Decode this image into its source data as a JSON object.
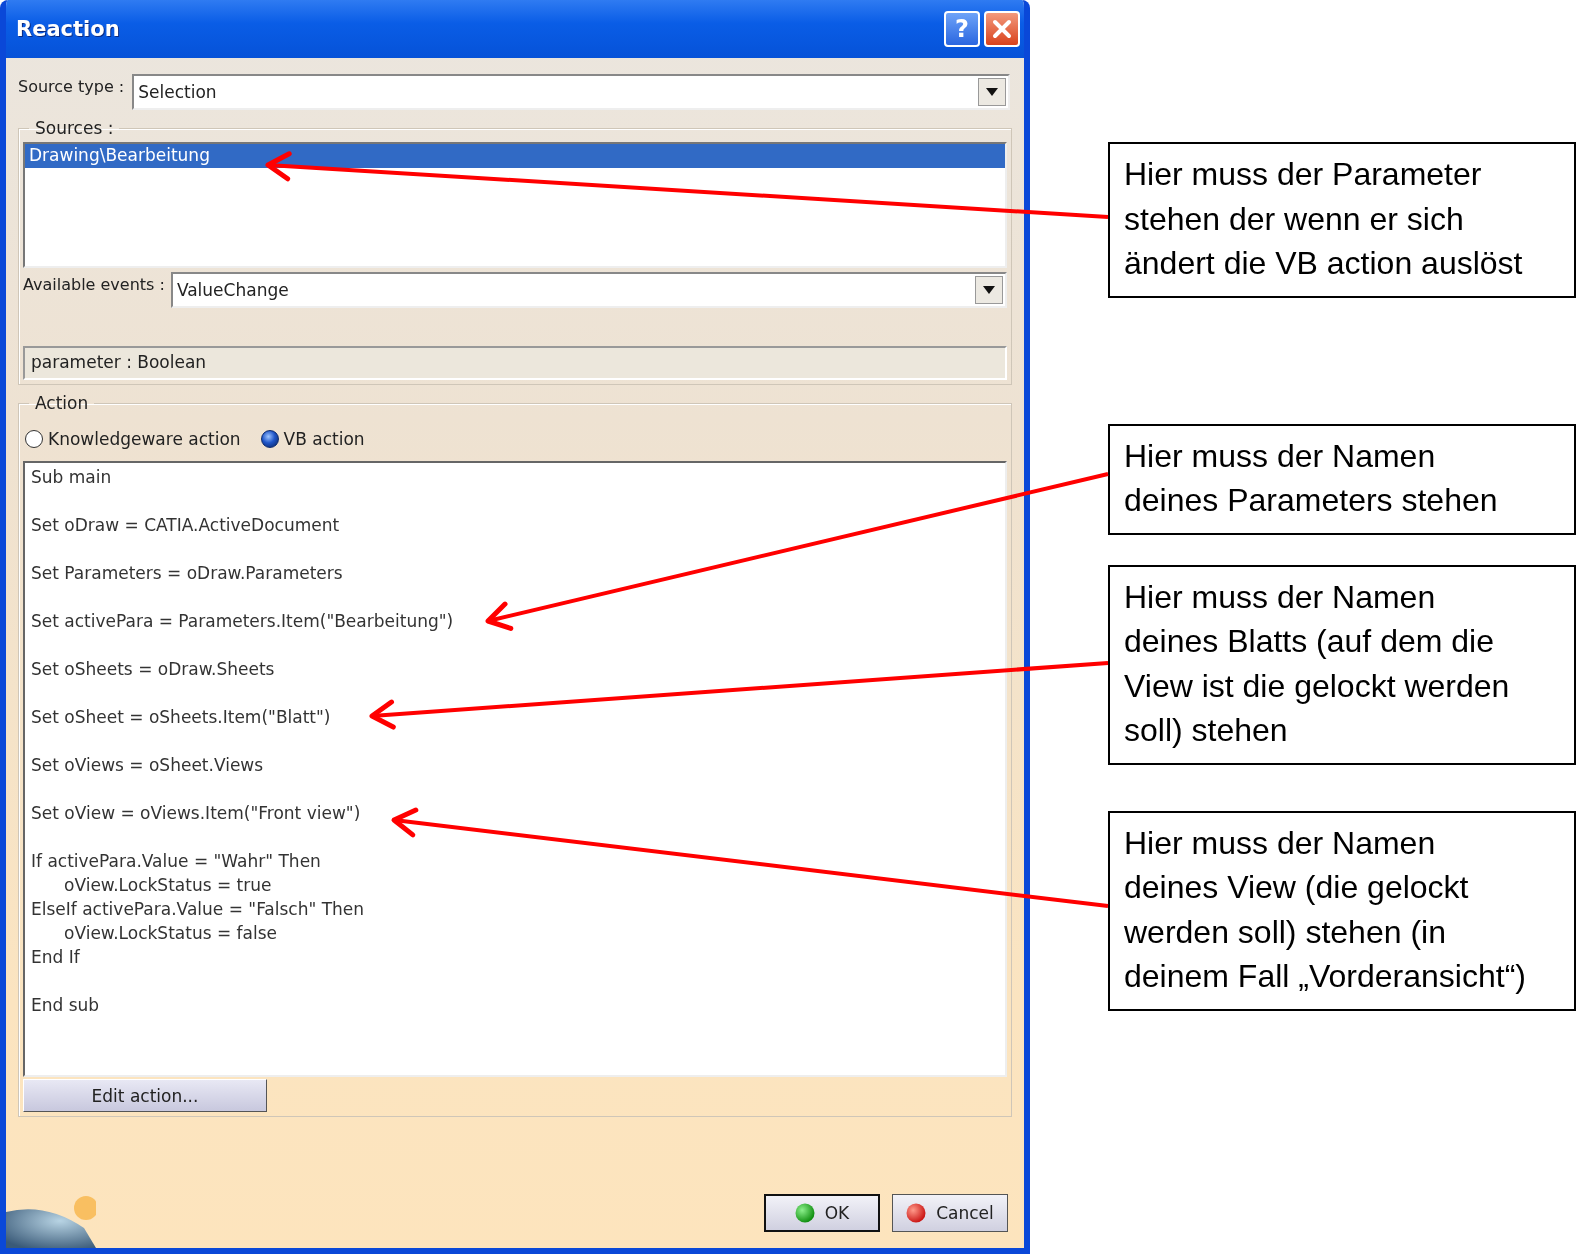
{
  "window": {
    "title": "Reaction",
    "help_button": "?"
  },
  "source_type": {
    "label": "Source type :",
    "value": "Selection"
  },
  "sources": {
    "legend": "Sources :",
    "items": [
      {
        "text": "Drawing\\Bearbeitung",
        "selected": true
      }
    ]
  },
  "available_events": {
    "label": "Available events :",
    "value": "ValueChange"
  },
  "parameter_field": {
    "value": "parameter : Boolean"
  },
  "action": {
    "legend": "Action",
    "options": [
      {
        "label": "Knowledgeware action",
        "selected": false
      },
      {
        "label": "VB action",
        "selected": true
      }
    ],
    "code_blocks": [
      [
        {
          "text": "Sub main",
          "indented": false
        }
      ],
      [
        {
          "text": "Set oDraw = CATIA.ActiveDocument",
          "indented": false
        }
      ],
      [
        {
          "text": "Set Parameters = oDraw.Parameters",
          "indented": false
        }
      ],
      [
        {
          "text": "Set activePara = Parameters.Item(\"Bearbeitung\")",
          "indented": false
        }
      ],
      [
        {
          "text": "Set oSheets = oDraw.Sheets",
          "indented": false
        }
      ],
      [
        {
          "text": "Set oSheet = oSheets.Item(\"Blatt\")",
          "indented": false
        }
      ],
      [
        {
          "text": "Set oViews = oSheet.Views",
          "indented": false
        }
      ],
      [
        {
          "text": "Set oView = oViews.Item(\"Front view\")",
          "indented": false
        }
      ],
      [
        {
          "text": "If activePara.Value = \"Wahr\" Then",
          "indented": false
        },
        {
          "text": "oView.LockStatus = true",
          "indented": true
        },
        {
          "text": "ElseIf activePara.Value = \"Falsch\" Then",
          "indented": false
        },
        {
          "text": "oView.LockStatus = false",
          "indented": true
        },
        {
          "text": "End If",
          "indented": false
        }
      ],
      [
        {
          "text": "End sub",
          "indented": false
        }
      ]
    ],
    "edit_button": "Edit action..."
  },
  "buttons": [
    {
      "label": "OK",
      "kind": "ok"
    },
    {
      "label": "Cancel",
      "kind": "cancel"
    }
  ],
  "callouts": [
    {
      "text": "Hier muss der Parameter stehen der wenn er sich ändert die VB action auslöst"
    },
    {
      "text": "Hier muss der Namen deines Parameters stehen"
    },
    {
      "text": "Hier muss der Namen deines Blatts (auf dem die View ist die gelockt werden soll) stehen"
    },
    {
      "text": "Hier muss der Namen deines View (die gelockt werden soll) stehen (in deinem Fall „Vorderansicht“)"
    }
  ]
}
